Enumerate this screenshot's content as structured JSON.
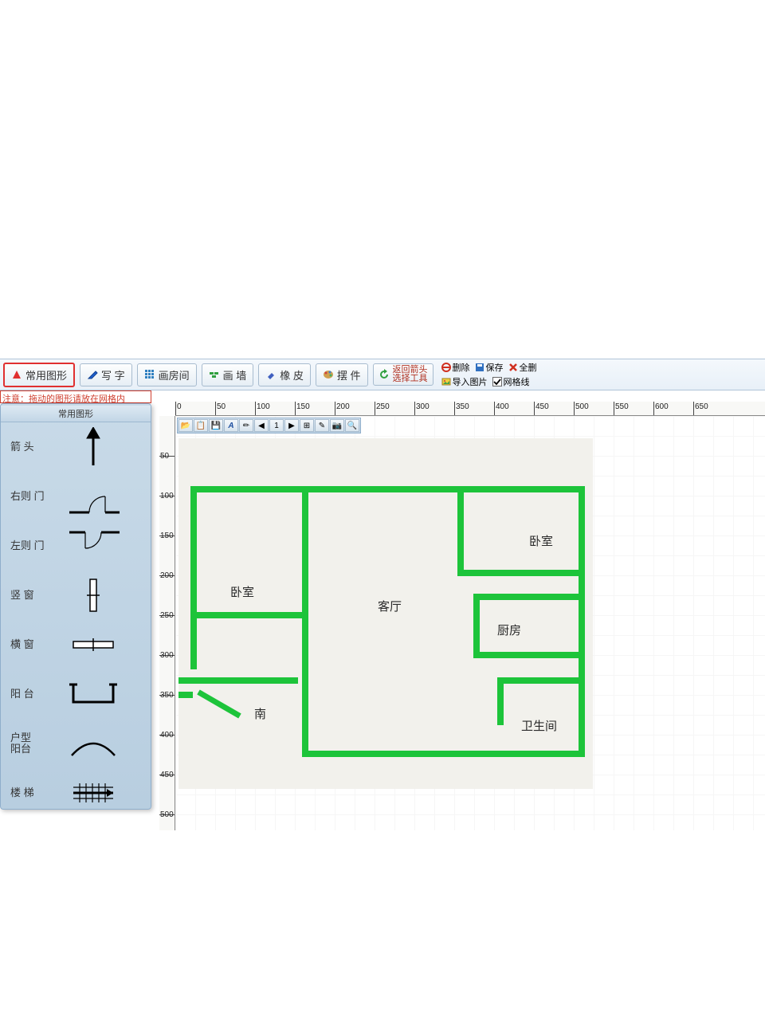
{
  "toolbar": {
    "common_shapes": "常用图形",
    "write_text": "写 字",
    "draw_room": "画房间",
    "draw_wall": "画 墙",
    "eraser": "橡 皮",
    "furniture": "摆 件",
    "return_arrow_line1": "返回箭头",
    "return_arrow_line2": "选择工具",
    "delete": "删除",
    "save": "保存",
    "delete_all": "全删",
    "import_image": "导入图片",
    "grid_lines": "网格线"
  },
  "notice": "注意：拖动的图形请放在网格内",
  "palette": {
    "title": "常用图形",
    "items": [
      {
        "label": "箭 头",
        "type": "arrow"
      },
      {
        "label": "右则 门",
        "type": "door-right"
      },
      {
        "label": "左则 门",
        "type": "door-left"
      },
      {
        "label": "竖 窗",
        "type": "v-window"
      },
      {
        "label": "横 窗",
        "type": "h-window"
      },
      {
        "label": "阳 台",
        "type": "balcony"
      },
      {
        "label": "户型\n阳台",
        "type": "arc-balcony"
      },
      {
        "label": "楼 梯",
        "type": "stairs"
      }
    ]
  },
  "ruler_h": [
    0,
    50,
    100,
    150,
    200,
    250,
    300,
    350,
    400,
    450,
    500,
    550,
    600,
    650
  ],
  "ruler_v": [
    50,
    100,
    150,
    200,
    250,
    300,
    350,
    400,
    450,
    500
  ],
  "rooms": {
    "bedroom1": "卧室",
    "bedroom2": "卧室",
    "living": "客厅",
    "kitchen": "厨房",
    "bathroom": "卫生间",
    "south": "南"
  },
  "colors": {
    "wall": "#1dc43a",
    "accent": "#d04030"
  }
}
